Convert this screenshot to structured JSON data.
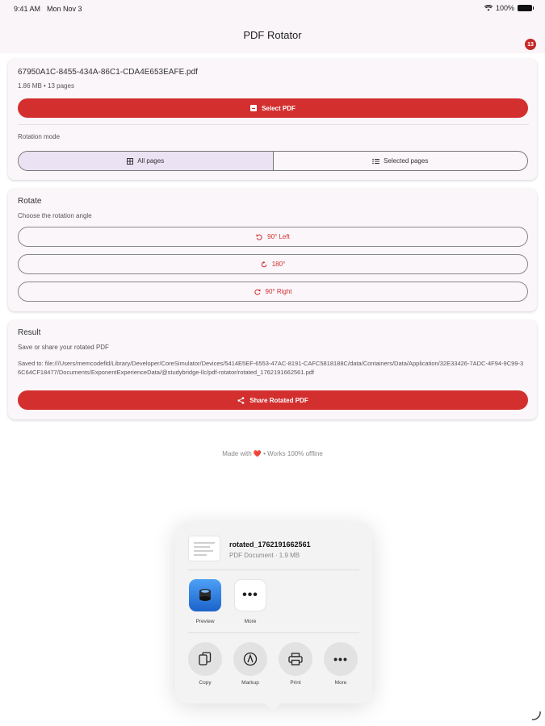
{
  "status_bar": {
    "time": "9:41 AM",
    "date": "Mon Nov 3",
    "battery": "100%"
  },
  "nav": {
    "title": "PDF Rotator",
    "badge_count": "13"
  },
  "file_card": {
    "filename": "67950A1C-8455-434A-86C1-CDA4E653EAFE.pdf",
    "info": "1.86 MB • 13 pages",
    "select_label": "Select PDF",
    "rotation_mode_label": "Rotation mode",
    "modes": [
      {
        "label": "All pages",
        "active": true
      },
      {
        "label": "Selected pages",
        "active": false
      }
    ]
  },
  "rotate_card": {
    "title": "Rotate",
    "subtitle": "Choose the rotation angle",
    "options": [
      {
        "label": "90° Left",
        "icon": "rotate-left-icon"
      },
      {
        "label": "180°",
        "icon": "rotate-180-icon"
      },
      {
        "label": "90° Right",
        "icon": "rotate-right-icon"
      }
    ]
  },
  "result_card": {
    "title": "Result",
    "subtitle": "Save or share your rotated PDF",
    "saved_path": "Saved to: file:///Users/memcodefld/Library/Developer/CoreSimulator/Devices/5414E5EF-6553-47AC-8191-CAFC5818188C/data/Containers/Data/Application/32E33426-7ADC-4F94-9C99-36C64CF18477/Documents/ExponentExperienceData/@studybridge-llc/pdf-rotator/rotated_1762191662561.pdf",
    "share_label": "Share Rotated PDF"
  },
  "footer": {
    "prefix": "Made with",
    "heart": "❤️",
    "suffix": "• Works 100% offline"
  },
  "share_sheet": {
    "doc_name": "rotated_1762191662561",
    "doc_meta": "PDF Document · 1.9 MB",
    "apps": [
      {
        "label": "Preview",
        "icon": "preview-app-icon"
      },
      {
        "label": "More",
        "icon": "more-apps-icon"
      }
    ],
    "actions": [
      {
        "label": "Copy",
        "icon": "copy-icon"
      },
      {
        "label": "Markup",
        "icon": "markup-icon"
      },
      {
        "label": "Print",
        "icon": "print-icon"
      },
      {
        "label": "More",
        "icon": "more-icon"
      }
    ]
  },
  "colors": {
    "accent": "#d32f2f",
    "background": "#faf5f9",
    "active_segment": "#ebe2f3"
  }
}
